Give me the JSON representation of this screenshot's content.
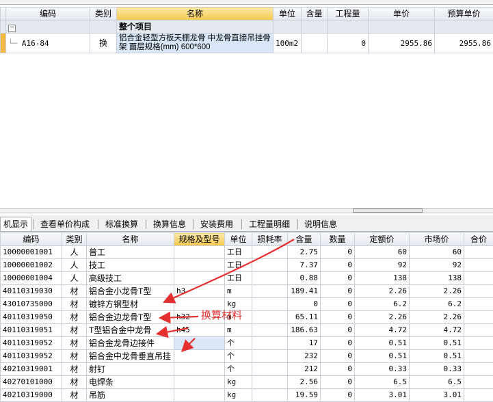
{
  "top_table": {
    "headers": [
      "编码",
      "类别",
      "名称",
      "单位",
      "含量",
      "工程量",
      "单价",
      "预算单价"
    ],
    "group_label": "整个项目",
    "row": {
      "code": "A16-84",
      "category": "换",
      "name": "铝合金轻型方板天棚龙骨 中龙骨直接吊挂骨架 面层规格(mm) 600*600",
      "unit": "100m2",
      "content": "",
      "quantity": "0",
      "unit_price": "2955.86",
      "budget_price": "2955.86"
    }
  },
  "tabs": [
    "机显示",
    "查看单价构成",
    "标准换算",
    "换算信息",
    "安装费用",
    "工程量明细",
    "说明信息"
  ],
  "bottom_table": {
    "headers": [
      "编码",
      "类别",
      "名称",
      "规格及型号",
      "单位",
      "损耗率",
      "含量",
      "数量",
      "定额价",
      "市场价",
      "合价"
    ],
    "rows": [
      {
        "code": "10000001001",
        "cat": "人",
        "name": "普工",
        "spec": "",
        "unit": "工日",
        "loss": "",
        "content": "2.75",
        "qty": "0",
        "quota": "60",
        "market": "60"
      },
      {
        "code": "10000001002",
        "cat": "人",
        "name": "技工",
        "spec": "",
        "unit": "工日",
        "loss": "",
        "content": "7.37",
        "qty": "0",
        "quota": "92",
        "market": "92"
      },
      {
        "code": "10000001004",
        "cat": "人",
        "name": "高级技工",
        "spec": "",
        "unit": "工日",
        "loss": "",
        "content": "0.88",
        "qty": "0",
        "quota": "138",
        "market": "138"
      },
      {
        "code": "40110319030",
        "cat": "材",
        "name": "铝合金小龙骨T型",
        "spec": "h3",
        "unit": "m",
        "loss": "",
        "content": "189.41",
        "qty": "0",
        "quota": "2.26",
        "market": "2.26"
      },
      {
        "code": "43010735000",
        "cat": "材",
        "name": "镀锌方钢型材",
        "spec": "",
        "unit": "kg",
        "loss": "",
        "content": "0",
        "qty": "0",
        "quota": "6.2",
        "market": "6.2"
      },
      {
        "code": "40110319050",
        "cat": "材",
        "name": "铝合金边龙骨T型",
        "spec": "h32",
        "unit": "m",
        "loss": "",
        "content": "65.11",
        "qty": "0",
        "quota": "2.26",
        "market": "2.26"
      },
      {
        "code": "40110319051",
        "cat": "材",
        "name": "T型铝合金中龙骨",
        "spec": "h45",
        "unit": "m",
        "loss": "",
        "content": "186.63",
        "qty": "0",
        "quota": "4.72",
        "market": "4.72"
      },
      {
        "code": "40110319052",
        "cat": "材",
        "name": "铝合金龙骨边接件",
        "spec": "",
        "unit": "个",
        "loss": "",
        "content": "17",
        "qty": "0",
        "quota": "0.51",
        "market": "0.51"
      },
      {
        "code": "40110319052",
        "cat": "材",
        "name": "铝合金中龙骨垂直吊挂",
        "spec": "",
        "unit": "个",
        "loss": "",
        "content": "232",
        "qty": "0",
        "quota": "0.51",
        "market": "0.51"
      },
      {
        "code": "40210319001",
        "cat": "材",
        "name": "射钉",
        "spec": "",
        "unit": "个",
        "loss": "",
        "content": "212",
        "qty": "0",
        "quota": "0.33",
        "market": "0.33"
      },
      {
        "code": "40270101000",
        "cat": "材",
        "name": "电焊条",
        "spec": "",
        "unit": "kg",
        "loss": "",
        "content": "2.56",
        "qty": "0",
        "quota": "6.5",
        "market": "6.5"
      },
      {
        "code": "40210319000",
        "cat": "材",
        "name": "吊筋",
        "spec": "",
        "unit": "kg",
        "loss": "",
        "content": "19.59",
        "qty": "0",
        "quota": "3.01",
        "market": "3.01"
      }
    ]
  },
  "annotation": {
    "text": "换算材料",
    "color": "#e53030"
  }
}
